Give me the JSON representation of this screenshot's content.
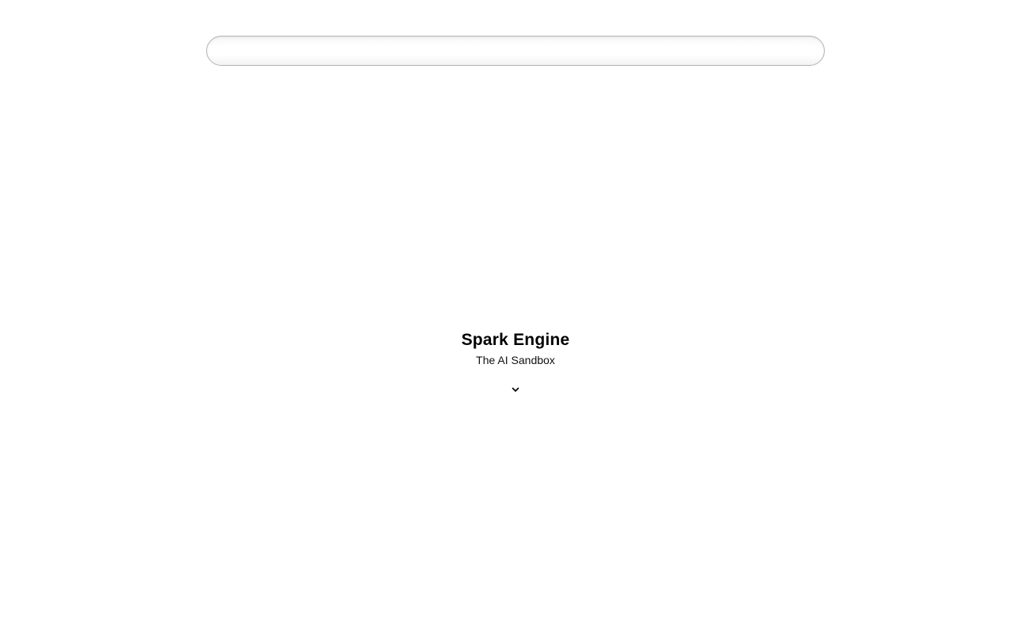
{
  "search": {
    "value": "",
    "placeholder": ""
  },
  "hero": {
    "title": "Spark Engine",
    "subtitle": "The AI Sandbox"
  },
  "scroll_down": {
    "icon": "chevron-down-icon"
  },
  "colors": {
    "background": "#ffffff",
    "text": "#000000",
    "search_border": "#b5b5b5"
  }
}
